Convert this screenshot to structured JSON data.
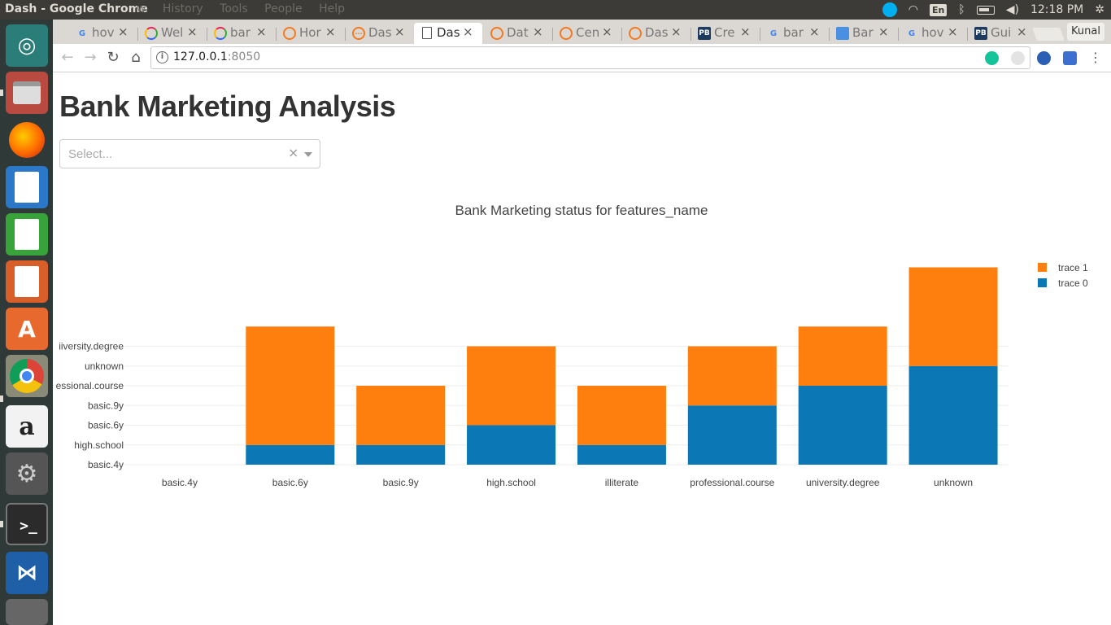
{
  "os": {
    "window_title": "Dash - Google Chrome",
    "menus": [
      "w",
      "History",
      "Tools",
      "People",
      "Help"
    ],
    "clock": "12:18 PM",
    "keyboard_lang": "En",
    "launcher_apps": [
      "ubuntu-dash-icon",
      "files-icon",
      "firefox-icon",
      "writer-icon",
      "calc-icon",
      "impress-icon",
      "software-center-icon",
      "chrome-icon",
      "amazon-icon",
      "settings-icon",
      "terminal-icon",
      "vscode-icon",
      "trash-icon"
    ]
  },
  "browser": {
    "tabs": [
      {
        "label": "hov",
        "icon": "google-icon"
      },
      {
        "label": "Wel",
        "icon": "plotly-icon"
      },
      {
        "label": "bar",
        "icon": "plotly-icon"
      },
      {
        "label": "Hor",
        "icon": "ring-icon"
      },
      {
        "label": "Das",
        "icon": "dots-icon"
      },
      {
        "label": "Das",
        "icon": "page-icon",
        "active": true
      },
      {
        "label": "Dat",
        "icon": "ring-icon"
      },
      {
        "label": "Cen",
        "icon": "ring-icon"
      },
      {
        "label": "Das",
        "icon": "ring-icon"
      },
      {
        "label": "Cre",
        "icon": "pb-icon"
      },
      {
        "label": "bar",
        "icon": "google-icon"
      },
      {
        "label": "Bar",
        "icon": "chart-icon"
      },
      {
        "label": "hov",
        "icon": "google-icon"
      },
      {
        "label": "Gui",
        "icon": "pb-icon"
      }
    ],
    "tab_close": "×",
    "profile_name": "Kunal",
    "url_host": "127.0.0.1",
    "url_port": ":8050"
  },
  "page": {
    "title": "Bank Marketing Analysis",
    "dropdown": {
      "placeholder": "Select...",
      "clear": "×"
    }
  },
  "chart_data": {
    "type": "bar",
    "barmode": "stack",
    "title": "Bank Marketing status for features_name",
    "categories": [
      "basic.4y",
      "basic.6y",
      "basic.9y",
      "high.school",
      "illiterate",
      "professional.course",
      "university.degree",
      "unknown"
    ],
    "y_tick_labels": [
      "basic.4y",
      "high.school",
      "basic.6y",
      "basic.9y",
      "professional.course",
      "unknown",
      "university.degree"
    ],
    "y_tick_labels_rendered": [
      "basic.4y",
      "high.school",
      "basic.6y",
      "basic.9y",
      "essional.course",
      "unknown",
      "iiversity.degree"
    ],
    "series": [
      {
        "name": "trace 0",
        "color": "#0b77b4",
        "values": [
          0,
          1,
          1,
          2,
          1,
          3,
          4,
          5
        ]
      },
      {
        "name": "trace 1",
        "color": "#ff7f0e",
        "values": [
          0,
          6,
          3,
          4,
          3,
          3,
          3,
          5
        ]
      }
    ],
    "legend_position": "top-right",
    "legend_order": [
      "trace 1",
      "trace 0"
    ],
    "grid": true
  }
}
